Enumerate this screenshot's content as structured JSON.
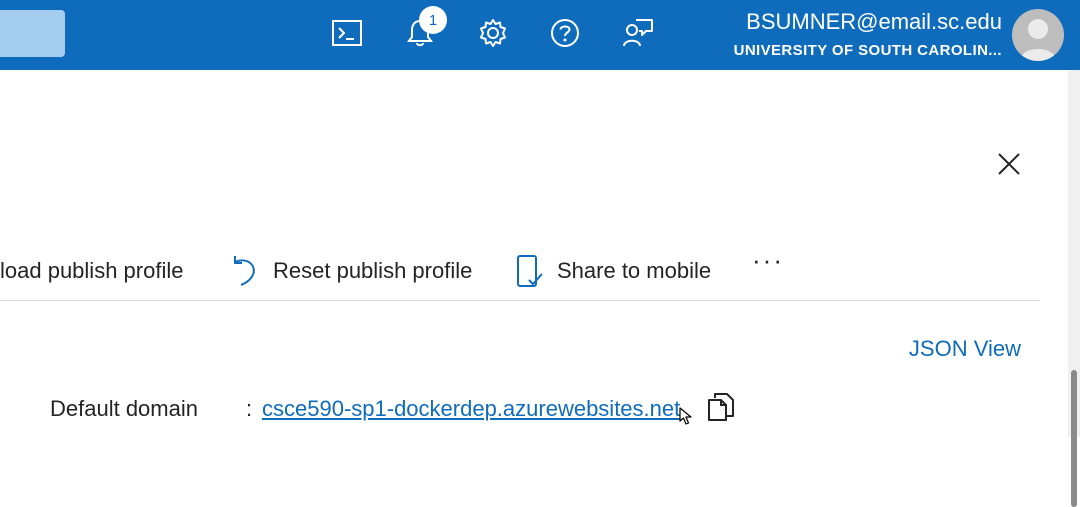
{
  "header": {
    "notifications_count": "1",
    "account_email": "BSUMNER@email.sc.edu",
    "account_org": "UNIVERSITY OF SOUTH CAROLIN...",
    "icons": [
      "cloud-shell-icon",
      "notifications-icon",
      "settings-icon",
      "help-icon",
      "feedback-icon"
    ]
  },
  "toolbar": {
    "download_label": "load publish profile",
    "reset_label": "Reset publish profile",
    "share_label": "Share to mobile",
    "more_label": "···"
  },
  "essentials": {
    "json_view_label": "JSON View",
    "default_domain_label": "Default domain",
    "separator": ":",
    "default_domain_value": "csce590-sp1-dockerdep.azurewebsites.net"
  },
  "colors": {
    "topbar": "#0f6cbd",
    "link": "#0f6cbd",
    "text": "#242424"
  }
}
